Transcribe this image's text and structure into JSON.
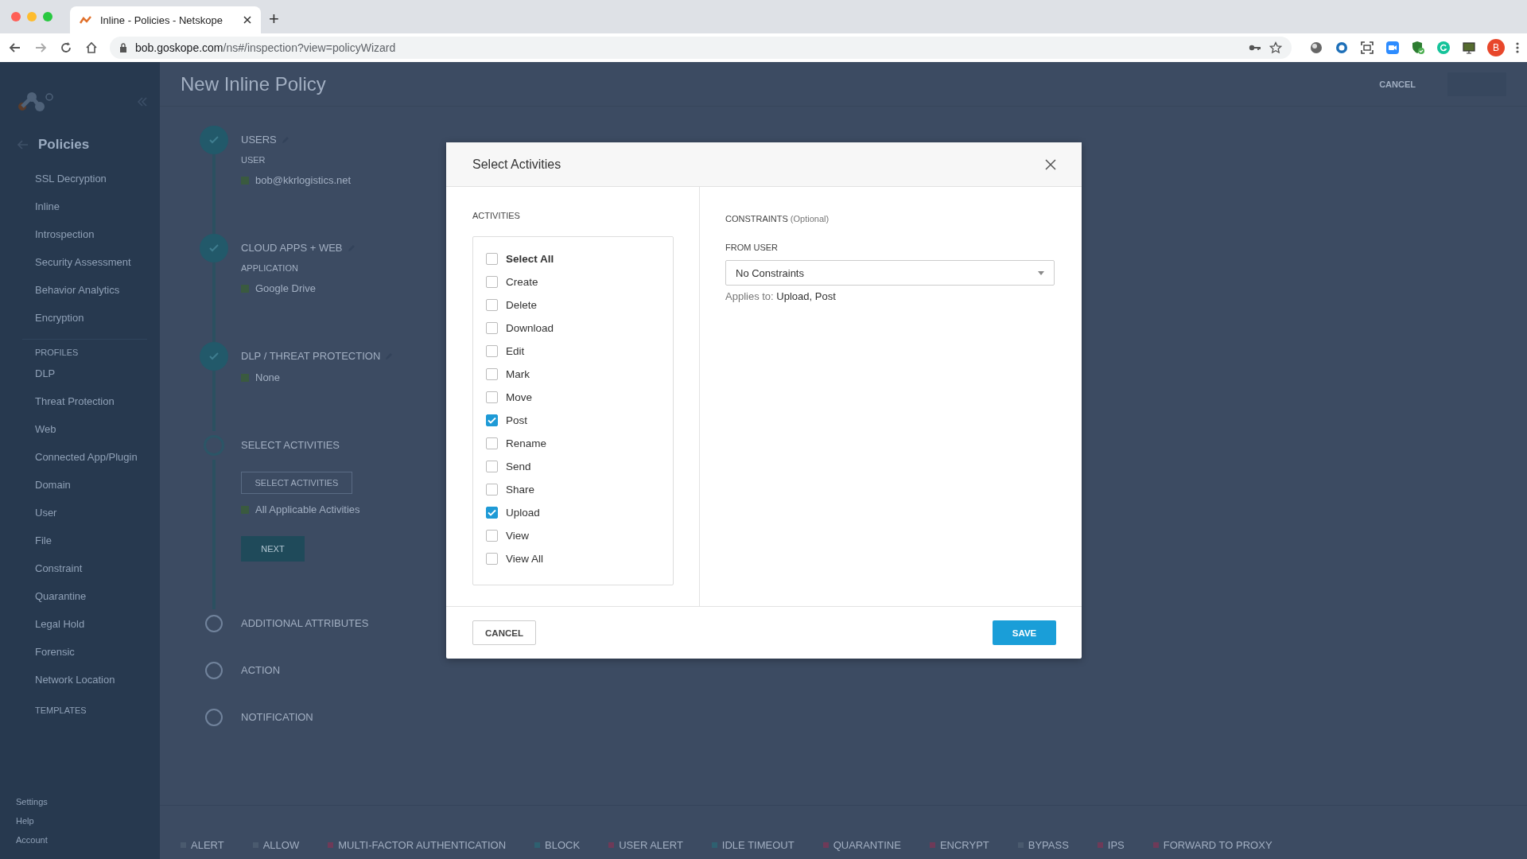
{
  "browser": {
    "tab_title": "Inline - Policies - Netskope",
    "new_tab": "+",
    "url_host": "bob.goskope.com",
    "url_path": "/ns#/inspection?view=policyWizard",
    "profile_initial": "B"
  },
  "sidebar": {
    "back_title": "Policies",
    "items": [
      "SSL Decryption",
      "Inline",
      "Introspection",
      "Security Assessment",
      "Behavior Analytics",
      "Encryption"
    ],
    "section": "PROFILES",
    "profiles": [
      "DLP",
      "Threat Protection",
      "Web",
      "Connected App/Plugin",
      "Domain",
      "User",
      "File",
      "Constraint",
      "Quarantine",
      "Legal Hold",
      "Forensic",
      "Network Location"
    ],
    "templates": "TEMPLATES",
    "footer": [
      "Settings",
      "Help",
      "Account"
    ]
  },
  "page": {
    "title": "New Inline Policy",
    "cancel": "CANCEL",
    "steps": [
      {
        "title": "USERS",
        "done": true,
        "field_label": "USER",
        "value": "bob@kkrlogistics.net"
      },
      {
        "title": "CLOUD APPS + WEB",
        "done": true,
        "field_label": "APPLICATION",
        "value": "Google Drive"
      },
      {
        "title": "DLP / THREAT PROTECTION",
        "done": true,
        "value": "None"
      },
      {
        "title": "SELECT ACTIVITIES",
        "done": false,
        "button": "SELECT ACTIVITIES",
        "value": "All Applicable Activities",
        "next": "NEXT"
      },
      {
        "title": "ADDITIONAL ATTRIBUTES",
        "done": false
      },
      {
        "title": "ACTION",
        "done": false
      },
      {
        "title": "NOTIFICATION",
        "done": false
      }
    ],
    "legend": [
      {
        "label": "ALERT",
        "color": "#4a5a6e"
      },
      {
        "label": "ALLOW",
        "color": "#4a5a6e"
      },
      {
        "label": "MULTI-FACTOR AUTHENTICATION",
        "color": "#6e3a58"
      },
      {
        "label": "BLOCK",
        "color": "#2e6070"
      },
      {
        "label": "USER ALERT",
        "color": "#6e3a58"
      },
      {
        "label": "IDLE TIMEOUT",
        "color": "#2e6070"
      },
      {
        "label": "QUARANTINE",
        "color": "#6e3a58"
      },
      {
        "label": "ENCRYPT",
        "color": "#6e3a58"
      },
      {
        "label": "BYPASS",
        "color": "#4a5a6e"
      },
      {
        "label": "IPS",
        "color": "#6e3a58"
      },
      {
        "label": "FORWARD TO PROXY",
        "color": "#6e3a58"
      }
    ]
  },
  "dialog": {
    "title": "Select Activities",
    "activities_heading": "ACTIVITIES",
    "activities": [
      {
        "label": "Select All",
        "kind": "all",
        "checked": false
      },
      {
        "label": "Create",
        "kind": "item",
        "checked": false
      },
      {
        "label": "Delete",
        "kind": "item",
        "checked": false
      },
      {
        "label": "Download",
        "kind": "item",
        "checked": false
      },
      {
        "label": "Edit",
        "kind": "item",
        "checked": false
      },
      {
        "label": "Mark",
        "kind": "item",
        "checked": false
      },
      {
        "label": "Move",
        "kind": "item",
        "checked": false
      },
      {
        "label": "Post",
        "kind": "item",
        "checked": true
      },
      {
        "label": "Rename",
        "kind": "item",
        "checked": false
      },
      {
        "label": "Send",
        "kind": "item",
        "checked": false
      },
      {
        "label": "Share",
        "kind": "item",
        "checked": false
      },
      {
        "label": "Upload",
        "kind": "item",
        "checked": true
      },
      {
        "label": "View",
        "kind": "item",
        "checked": false
      },
      {
        "label": "View All",
        "kind": "item",
        "checked": false
      }
    ],
    "constraints_heading": "CONSTRAINTS",
    "constraints_note": "(Optional)",
    "from_user_label": "FROM USER",
    "dropdown_value": "No Constraints",
    "applies_label": "Applies to:",
    "applies_value": "Upload, Post",
    "cancel": "CANCEL",
    "save": "SAVE"
  }
}
